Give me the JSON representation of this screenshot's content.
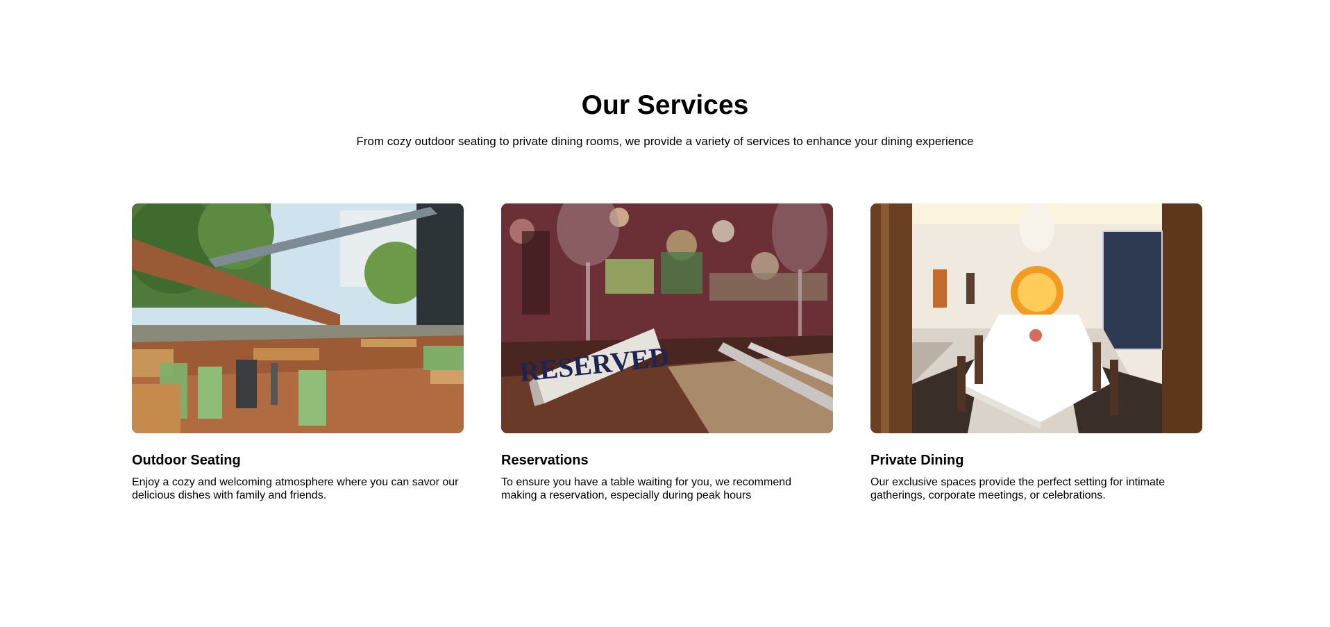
{
  "section": {
    "title": "Our Services",
    "subtitle": "From cozy outdoor seating to private dining rooms, we provide a variety of services to enhance your dining experience"
  },
  "cards": [
    {
      "title": "Outdoor Seating",
      "description": "Enjoy a cozy and welcoming atmosphere where you can savor our delicious dishes with family and friends.",
      "image": "outdoor-terrace-photo"
    },
    {
      "title": "Reservations",
      "description": "To ensure you have a table waiting for you, we recommend making a reservation, especially during peak hours",
      "image": "reserved-sign-photo",
      "image_text": "RESERVED"
    },
    {
      "title": "Private Dining",
      "description": "Our exclusive spaces provide the perfect setting for intimate gatherings, corporate meetings, or celebrations.",
      "image": "private-dining-room-photo"
    }
  ]
}
